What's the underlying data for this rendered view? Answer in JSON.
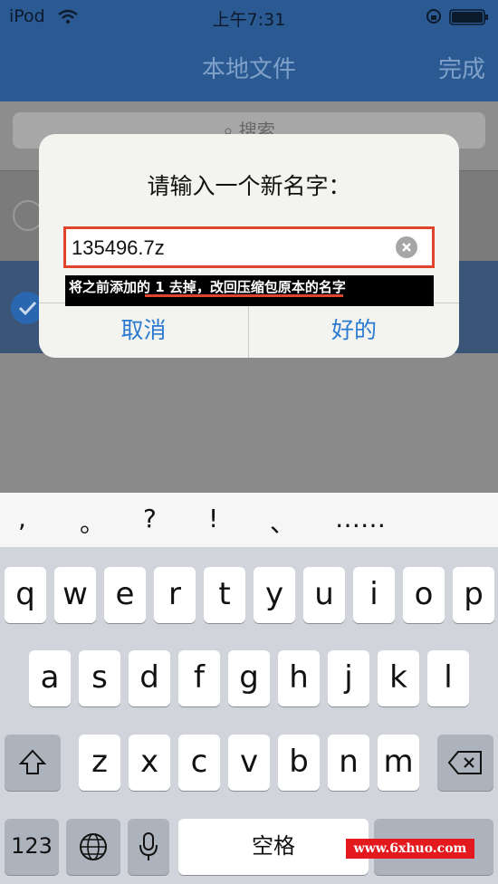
{
  "status_bar": {
    "carrier": "iPod",
    "time": "上午7:31"
  },
  "nav": {
    "title": "本地文件",
    "done_label": "完成"
  },
  "search": {
    "placeholder": "搜索"
  },
  "alert": {
    "title": "请输入一个新名字：",
    "input_value": "135496.7z",
    "cancel_label": "取消",
    "ok_label": "好的"
  },
  "annotation": {
    "text": "将之前添加的 1 去掉，改回压缩包原本的名字"
  },
  "keyboard": {
    "punctuation": [
      ",",
      "。",
      "?",
      "!",
      "、",
      "……"
    ],
    "row1": [
      "q",
      "w",
      "e",
      "r",
      "t",
      "y",
      "u",
      "i",
      "o",
      "p"
    ],
    "row2": [
      "a",
      "s",
      "d",
      "f",
      "g",
      "h",
      "j",
      "k",
      "l"
    ],
    "row3": [
      "z",
      "x",
      "c",
      "v",
      "b",
      "n",
      "m"
    ],
    "numbers_label": "123",
    "space_label": "空格"
  },
  "watermark": {
    "text": "www.6xhuo.com"
  },
  "colors": {
    "nav_bg": "#2b5a93",
    "highlight_red": "#e0442b",
    "button_blue": "#2a7ad2"
  }
}
